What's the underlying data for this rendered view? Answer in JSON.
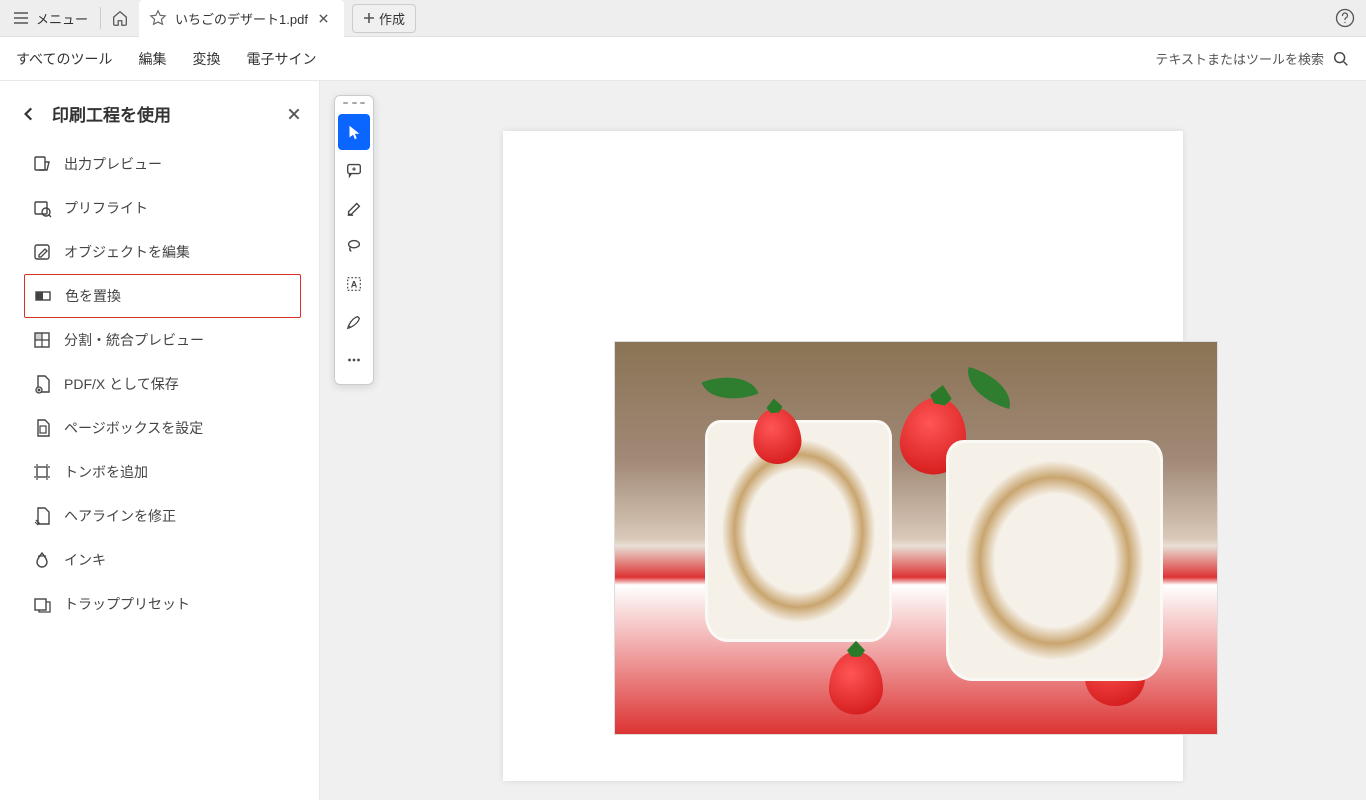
{
  "titlebar": {
    "menu_label": "メニュー",
    "tab_filename": "いちごのデザート1.pdf",
    "create_label": "作成"
  },
  "menubar": {
    "all_tools": "すべてのツール",
    "edit": "編集",
    "convert": "変換",
    "esign": "電子サイン",
    "search_placeholder": "テキストまたはツールを検索"
  },
  "panel": {
    "title": "印刷工程を使用",
    "items": [
      "出力プレビュー",
      "プリフライト",
      "オブジェクトを編集",
      "色を置換",
      "分割・統合プレビュー",
      "PDF/X として保存",
      "ページボックスを設定",
      "トンボを追加",
      "ヘアラインを修正",
      "インキ",
      "トラッププリセット"
    ],
    "highlighted_index": 3
  }
}
